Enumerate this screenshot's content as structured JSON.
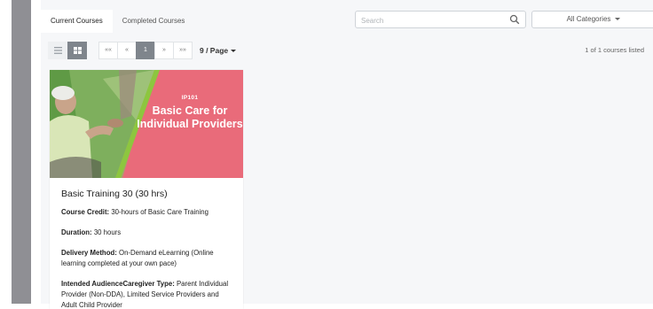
{
  "tabs": [
    {
      "label": "Current Courses",
      "active": true
    },
    {
      "label": "Completed Courses",
      "active": false
    }
  ],
  "search": {
    "placeholder": "Search",
    "icon": "search-icon"
  },
  "categories": {
    "selected": "All Categories",
    "icon": "chevron-down-icon"
  },
  "toolbar": {
    "view_list_icon": "list-icon",
    "view_grid_icon": "grid-icon",
    "pagination": {
      "first": "««",
      "prev": "«",
      "current": "1",
      "next": "»",
      "last": "»»"
    },
    "per_page": "9 / Page"
  },
  "results_count": "1 of 1 courses listed",
  "courses": [
    {
      "banner_code": "IP101",
      "banner_title": "Basic Care for Individual Providers",
      "title": "Basic Training 30 (30 hrs)",
      "fields": [
        {
          "label": "Course Credit:",
          "value": "30-hours of Basic Care Training"
        },
        {
          "label": "Duration:",
          "value": "30 hours"
        },
        {
          "label": "Delivery Method:",
          "value": "On-Demand eLearning (Online learning completed at your own pace)"
        },
        {
          "label": "Intended AudienceCaregiver Type:",
          "value": "Parent Individual Provider (Non-DDA), Limited Service Providers and Adult Child Provider"
        }
      ]
    }
  ],
  "colors": {
    "banner": "#e96b7a",
    "accent_green": "#8dc63f",
    "button_gray": "#7f858c"
  }
}
